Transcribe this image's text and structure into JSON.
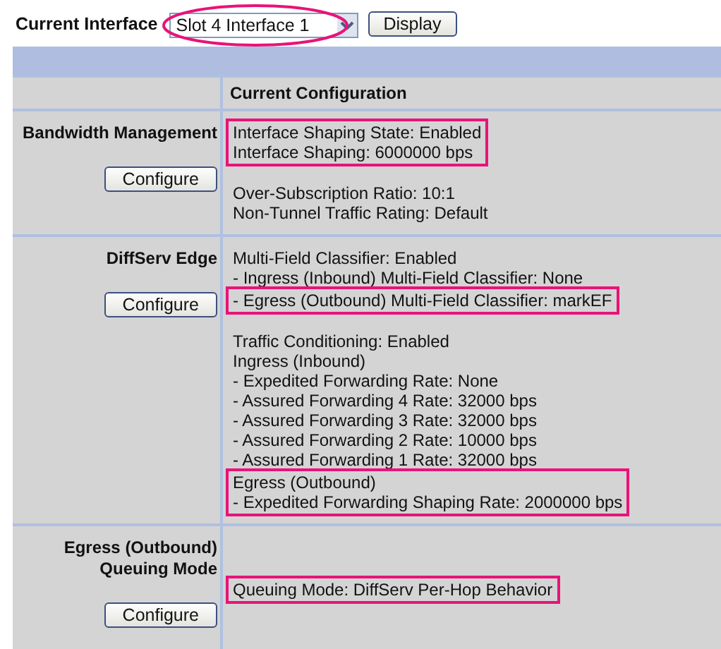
{
  "interface_bar": {
    "label": "Current Interface",
    "select": {
      "value": "Slot 4 Interface 1",
      "circled": true
    },
    "button": "Display"
  },
  "header": {
    "title": "Current Configuration"
  },
  "sections": [
    {
      "title": "Bandwidth Management",
      "button": "Configure",
      "groups": [
        {
          "highlighted": true,
          "spaced": false,
          "lines": [
            "Interface Shaping State: Enabled",
            "Interface Shaping: 6000000 bps"
          ]
        },
        {
          "highlighted": false,
          "spaced": true,
          "lines": [
            "Over-Subscription Ratio: 10:1",
            "Non-Tunnel Traffic Rating: Default"
          ]
        }
      ]
    },
    {
      "title": "DiffServ Edge",
      "button": "Configure",
      "groups": [
        {
          "highlighted": false,
          "spaced": false,
          "lines": [
            "Multi-Field Classifier: Enabled",
            "- Ingress (Inbound) Multi-Field Classifier: None"
          ]
        },
        {
          "highlighted": true,
          "spaced": false,
          "lines": [
            "- Egress (Outbound) Multi-Field Classifier: markEF"
          ]
        },
        {
          "highlighted": false,
          "spaced": true,
          "lines": [
            "Traffic Conditioning: Enabled",
            "Ingress (Inbound)",
            "- Expedited Forwarding Rate: None",
            "- Assured Forwarding 4 Rate: 32000 bps",
            "- Assured Forwarding 3 Rate: 32000 bps",
            "- Assured Forwarding 2 Rate: 10000 bps",
            "- Assured Forwarding 1 Rate: 32000 bps"
          ]
        },
        {
          "highlighted": true,
          "spaced": false,
          "lines": [
            "Egress (Outbound)",
            "- Expedited Forwarding Shaping Rate: 2000000 bps"
          ]
        }
      ]
    },
    {
      "title": "Egress (Outbound) Queuing Mode",
      "button": "Configure",
      "groups": [
        {
          "highlighted": true,
          "spaced": true,
          "lines": [
            "Queuing Mode: DiffServ Per-Hop Behavior"
          ]
        }
      ]
    }
  ]
}
